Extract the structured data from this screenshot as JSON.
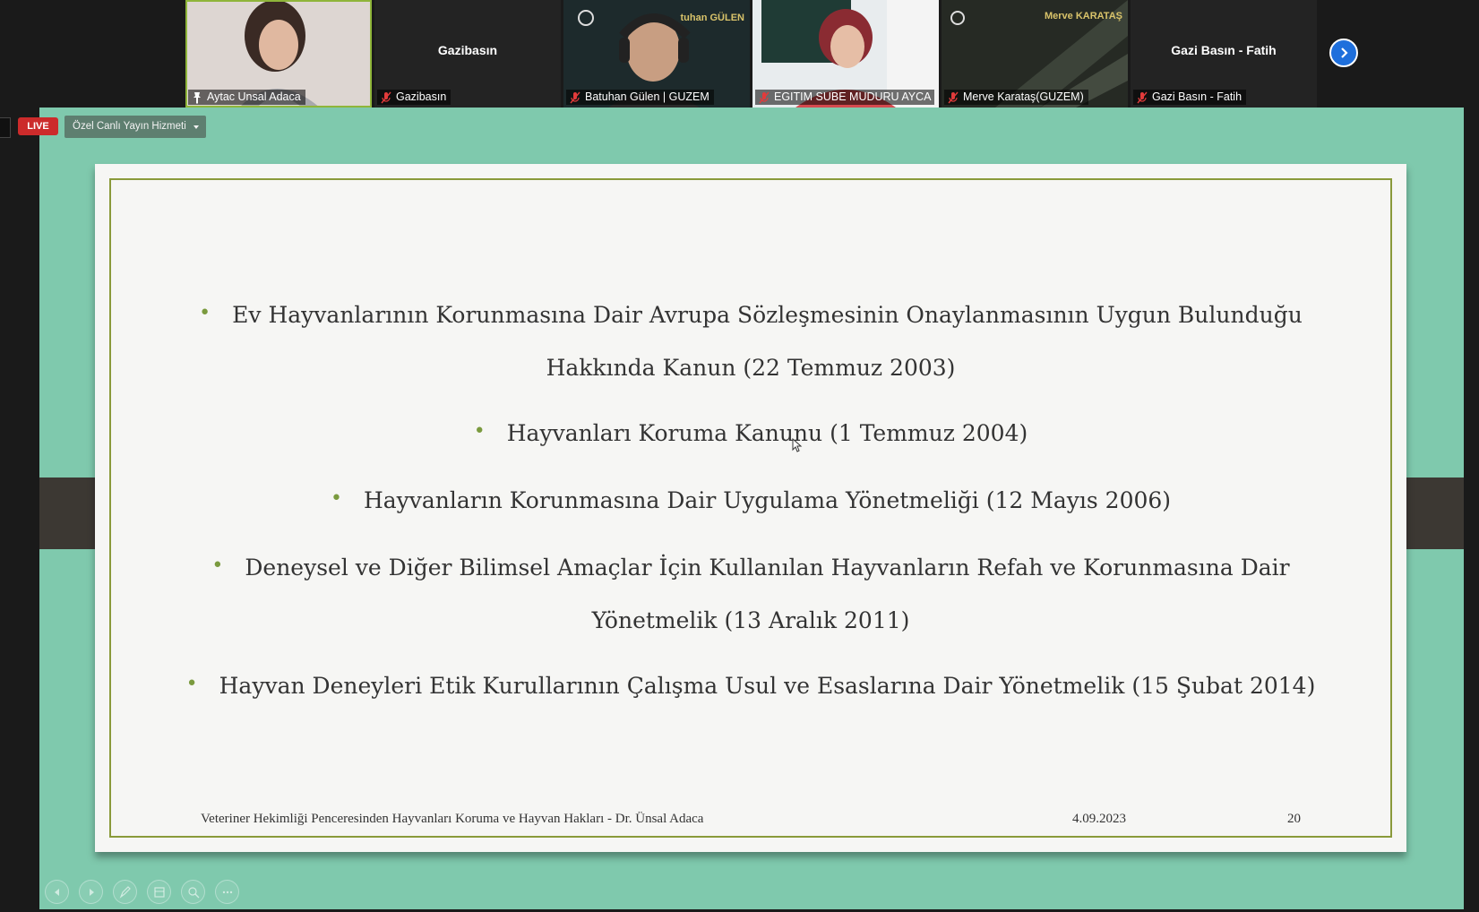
{
  "participants": [
    {
      "name": "Aytac Unsal Adaca",
      "pinned": true,
      "video": true
    },
    {
      "name": "Gazibasın",
      "display_name": "Gazibasın",
      "video": false
    },
    {
      "name": "Batuhan Gülen | GUZEM",
      "overlay": "tuhan GÜLEN",
      "video": true
    },
    {
      "name": "EGITIM SUBE MUDURU AYCA ...",
      "video": true
    },
    {
      "name": "Merve Karataş(GUZEM)",
      "overlay": "Merve KARATAŞ",
      "video": true
    },
    {
      "name": "Gazi Basın - Fatih",
      "display_name": "Gazi Basın - Fatih",
      "video": false
    }
  ],
  "live": {
    "badge": "LIVE",
    "stream_service": "Özel Canlı Yayın Hizmeti"
  },
  "slide": {
    "bullets": [
      {
        "line1": "Ev Hayvanlarının Korunmasına Dair Avrupa Sözleşmesinin Onaylanmasının Uygun Bulunduğu",
        "line2": "Hakkında Kanun (22 Temmuz 2003)"
      },
      {
        "line1": "Hayvanları Koruma Kanunu (1 Temmuz 2004)"
      },
      {
        "line1": "Hayvanların Korunmasına Dair Uygulama Yönetmeliği  (12 Mayıs 2006)"
      },
      {
        "line1": "Deneysel ve Diğer Bilimsel Amaçlar İçin Kullanılan Hayvanların Refah ve Korunmasına  Dair",
        "line2": "Yönetmelik  (13 Aralık 2011)"
      },
      {
        "line1": "Hayvan Deneyleri Etik Kurullarının Çalışma Usul ve Esaslarına Dair Yönetmelik  (15 Şubat 2014)"
      }
    ],
    "footer_title": "Veteriner Hekimliği Penceresinden Hayvanları Koruma ve Hayvan Hakları - Dr. Ünsal Adaca",
    "footer_date": "4.09.2023",
    "footer_page": "20"
  },
  "colors": {
    "share_background": "#7fc9ad",
    "live_red": "#cc2b2b",
    "bullet_green": "#7a9a3e",
    "frame_olive": "#8a9a3a",
    "next_blue": "#1e6fdc"
  },
  "toolbar_icons": [
    "previous-icon",
    "next-icon",
    "pen-icon",
    "layout-icon",
    "zoom-icon",
    "more-icon"
  ]
}
